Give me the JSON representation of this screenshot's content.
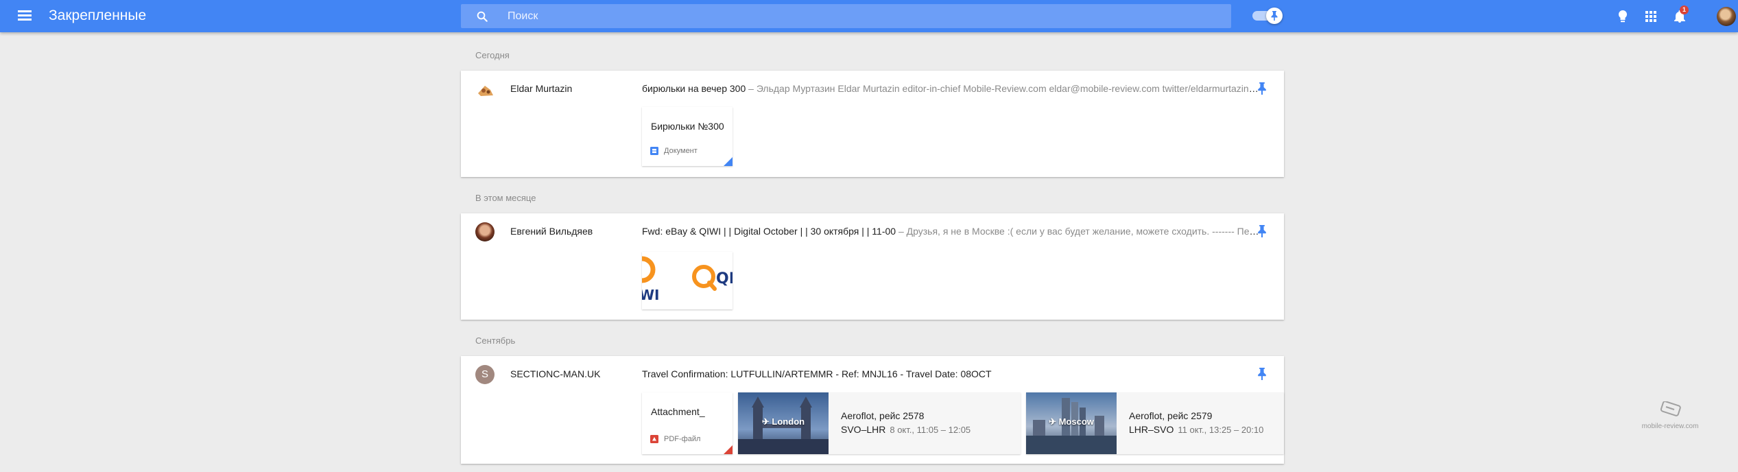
{
  "header": {
    "title": "Закрепленные",
    "search_placeholder": "Поиск",
    "notification_count": "1",
    "accent": "#4285f4"
  },
  "icons": {
    "menu": "menu-icon",
    "search": "search-icon",
    "pin_toggle": "pin-icon",
    "reminders": "bulb-icon",
    "apps": "apps-grid-icon",
    "notifications": "bell-icon",
    "account": "avatar"
  },
  "sections": [
    {
      "label": "Сегодня",
      "items": [
        {
          "sender": "Eldar Murtazin",
          "subject": "бирюльки на вечер 300",
          "snippet": " – Эльдар Муртазин Eldar Murtazin editor-in-chief Mobile-Review.com eldar@mobile-review.com twitter/eldarmurtazin Facebook",
          "attachment": {
            "title": "Бирюльки №300",
            "type": "Документ",
            "corner_color": "#4285f4"
          }
        }
      ]
    },
    {
      "label": "В этом месяце",
      "items": [
        {
          "sender": "Евгений Вильдяев",
          "subject": "Fwd: eBay & QIWI | | Digital October | | 30 октября | | 11-00",
          "snippet": " – Друзья, я не в Москве :( если у вас будет желание, можете сходить. ------- Пересылаемое сообщение"
        }
      ]
    },
    {
      "label": "Сентябрь",
      "items": [
        {
          "sender": "SECTIONC-MAN.UK",
          "avatar_letter": "S",
          "subject": "Travel Confirmation: LUTFULLIN/ARTEMMR - Ref: MNJL16 - Travel Date: 08OCT",
          "attachment": {
            "title": "Attachment_",
            "type": "PDF-файл",
            "corner_color": "#db4437"
          },
          "flights": [
            {
              "city": "✈ London",
              "name": "Aeroflot, рейс 2578",
              "route": "SVO–LHR",
              "time": "8 окт., 11:05 – 12:05"
            },
            {
              "city": "✈ Moscow",
              "name": "Aeroflot, рейс 2579",
              "route": "LHR–SVO",
              "time": "11 окт., 13:25 – 20:10"
            }
          ]
        }
      ]
    }
  ],
  "watermark": "mobile-review.com"
}
